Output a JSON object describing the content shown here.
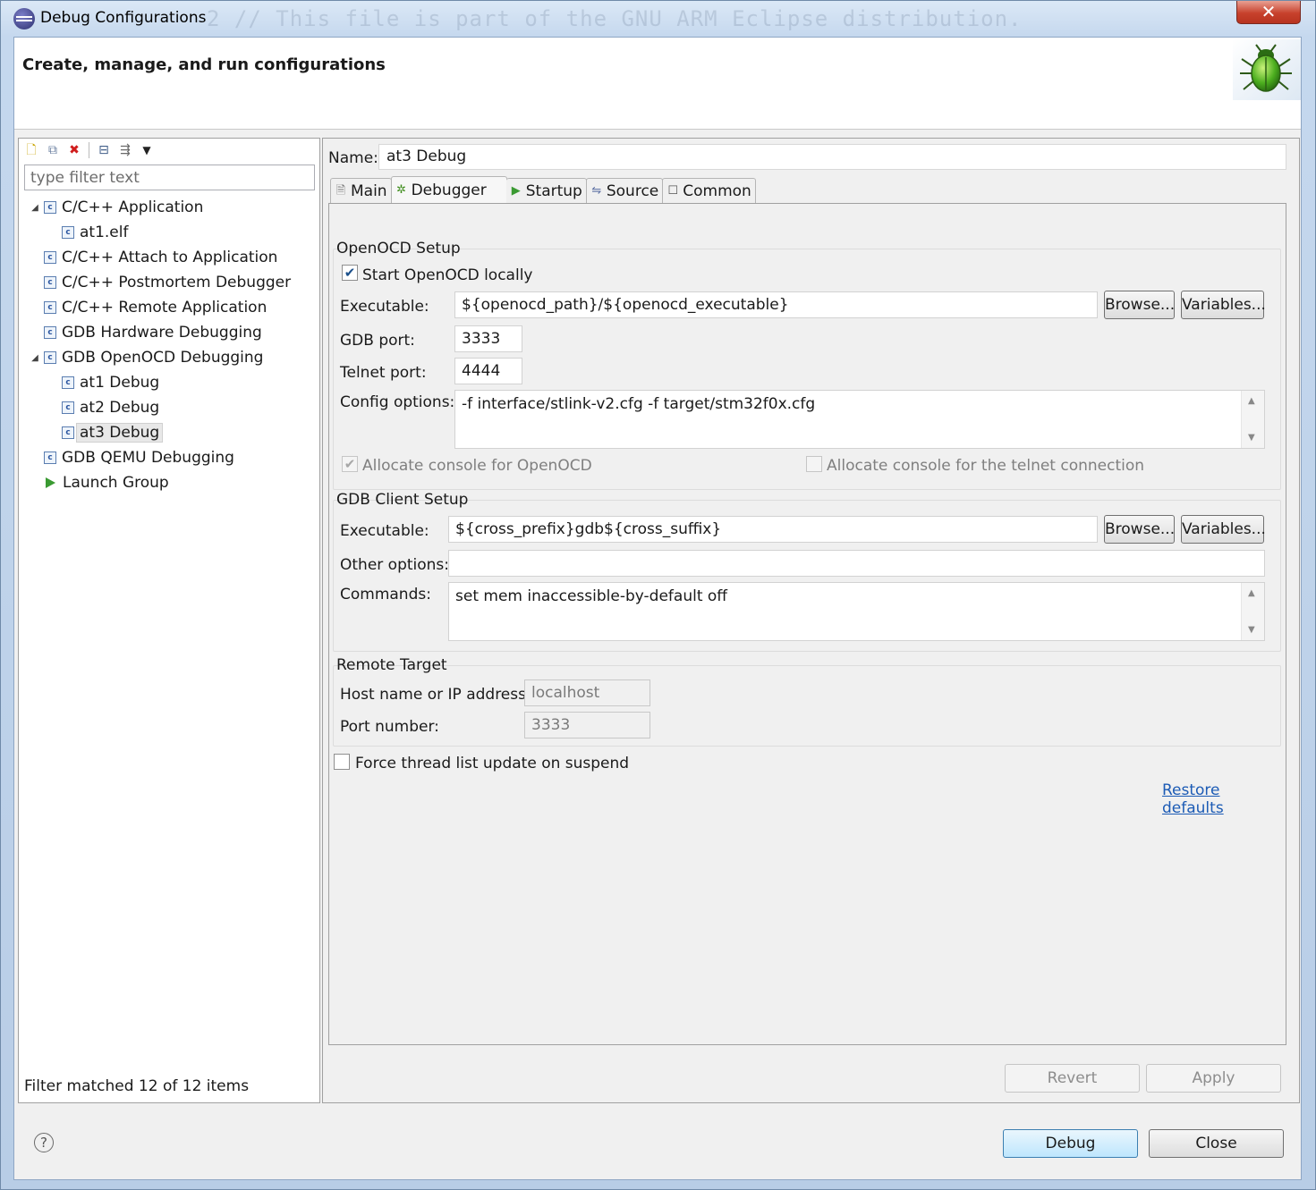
{
  "window": {
    "title": "Debug Configurations",
    "close_glyph": "✕",
    "background_code": "2 // This file is part of the GNU ARM Eclipse distribution."
  },
  "header": {
    "title": "Create, manage, and run configurations"
  },
  "left_panel": {
    "filter_placeholder": "type filter text",
    "toolbar": [
      "new-configuration-icon",
      "duplicate-icon",
      "delete-icon",
      "collapse-all-icon",
      "filter-icon",
      "dropdown-icon"
    ],
    "tree": [
      {
        "label": "C/C++ Application",
        "level": 0,
        "expanded": true
      },
      {
        "label": "at1.elf",
        "level": 1
      },
      {
        "label": "C/C++ Attach to Application",
        "level": 0
      },
      {
        "label": "C/C++ Postmortem Debugger",
        "level": 0
      },
      {
        "label": "C/C++ Remote Application",
        "level": 0
      },
      {
        "label": "GDB Hardware Debugging",
        "level": 0
      },
      {
        "label": "GDB OpenOCD Debugging",
        "level": 0,
        "expanded": true
      },
      {
        "label": "at1 Debug",
        "level": 1
      },
      {
        "label": "at2 Debug",
        "level": 1
      },
      {
        "label": "at3 Debug",
        "level": 1,
        "selected": true
      },
      {
        "label": "GDB QEMU Debugging",
        "level": 0
      },
      {
        "label": "Launch Group",
        "level": 0,
        "icon": "launch-icon"
      }
    ],
    "status": "Filter matched 12 of 12 items"
  },
  "config": {
    "name_label": "Name:",
    "name_value": "at3 Debug",
    "tabs": [
      {
        "label": "Main",
        "icon": "main-tab-icon"
      },
      {
        "label": "Debugger",
        "icon": "debugger-tab-icon",
        "active": true
      },
      {
        "label": "Startup",
        "icon": "startup-tab-icon"
      },
      {
        "label": "Source",
        "icon": "source-tab-icon"
      },
      {
        "label": "Common",
        "icon": "common-tab-icon"
      }
    ],
    "openocd": {
      "group_title": "OpenOCD Setup",
      "start_locally_label": "Start OpenOCD locally",
      "start_locally_checked": true,
      "executable_label": "Executable:",
      "executable_value": "${openocd_path}/${openocd_executable}",
      "browse_label": "Browse...",
      "variables_label": "Variables...",
      "gdb_port_label": "GDB port:",
      "gdb_port_value": "3333",
      "telnet_port_label": "Telnet port:",
      "telnet_port_value": "4444",
      "config_options_label": "Config options:",
      "config_options_value": "-f interface/stlink-v2.cfg -f target/stm32f0x.cfg",
      "allocate_console_label": "Allocate console for OpenOCD",
      "allocate_console_checked": true,
      "allocate_telnet_label": "Allocate console for the telnet connection",
      "allocate_telnet_checked": false
    },
    "gdb_client": {
      "group_title": "GDB Client Setup",
      "executable_label": "Executable:",
      "executable_value": "${cross_prefix}gdb${cross_suffix}",
      "browse_label": "Browse...",
      "variables_label": "Variables...",
      "other_options_label": "Other options:",
      "other_options_value": "",
      "commands_label": "Commands:",
      "commands_value": "set mem inaccessible-by-default off"
    },
    "remote_target": {
      "group_title": "Remote Target",
      "host_label": "Host name or IP address:",
      "host_value": "localhost",
      "port_label": "Port number:",
      "port_value": "3333"
    },
    "force_thread_label": "Force thread list update on suspend",
    "force_thread_checked": false,
    "restore_defaults_label": "Restore defaults",
    "revert_label": "Revert",
    "apply_label": "Apply"
  },
  "footer": {
    "help_glyph": "?",
    "debug_label": "Debug",
    "close_label": "Close"
  },
  "colors": {
    "link": "#1c5bb5",
    "bug_green": "#4cae1f"
  }
}
